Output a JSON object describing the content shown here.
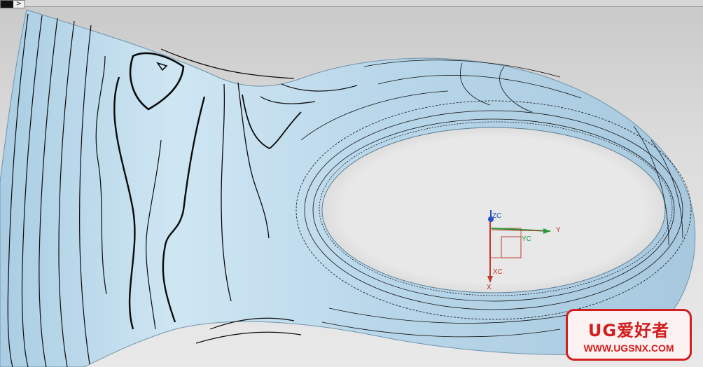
{
  "toolbar": {
    "expand_glyph": ">"
  },
  "csys": {
    "zc_label": "ZC",
    "yc_label": "YC",
    "xc_label": "XC",
    "y_label": "Y",
    "x_label": "X",
    "colors": {
      "x_axis": "#c0392b",
      "y_axis": "#1e9e3a",
      "z_axis": "#2b4fc0"
    }
  },
  "watermark": {
    "title": "UG爱好者",
    "url": "WWW.UGSNX.COM",
    "color": "#d21e1e"
  },
  "surface": {
    "fill": "#bcd9ea",
    "contour_color": "#0b0b0b"
  }
}
